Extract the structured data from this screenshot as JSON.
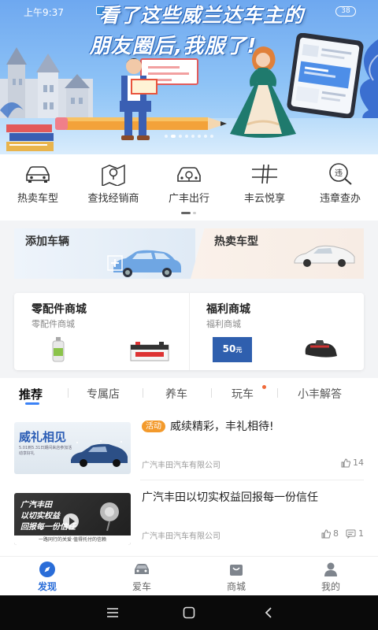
{
  "status_bar": {
    "time": "上午9:37",
    "battery": "38"
  },
  "banner": {
    "headline_line1": "看了这些威兰达车主的",
    "headline_line2": "朋友圈后,我服了!",
    "phone_caption": "朋友圈",
    "slide_count": 8,
    "active_slide": 1
  },
  "quick_menu": [
    {
      "label": "热卖车型",
      "icon": "car-front-icon"
    },
    {
      "label": "查找经销商",
      "icon": "map-pin-icon"
    },
    {
      "label": "广丰出行",
      "icon": "car-key-icon"
    },
    {
      "label": "丰云悦享",
      "icon": "road-sign-icon"
    },
    {
      "label": "违章查办",
      "icon": "violation-search-icon"
    }
  ],
  "promos": {
    "add_vehicle": "添加车辆",
    "hot_models": "热卖车型"
  },
  "mall": {
    "parts": {
      "title": "零配件商城",
      "subtitle": "零配件商城"
    },
    "welfare": {
      "title": "福利商城",
      "subtitle": "福利商城",
      "coupon_value": "50",
      "coupon_unit": "元"
    }
  },
  "tabs": [
    "推荐",
    "专属店",
    "养车",
    "玩车",
    "小丰解答"
  ],
  "active_tab": 0,
  "articles": [
    {
      "tag": "活动",
      "title": "威续精彩，丰礼相待!",
      "source": "广汽丰田汽车有限公司",
      "likes": "14",
      "thumb_title": "威礼相见",
      "thumb_sub": "5.01到5.31日期间来店参加活动享好礼"
    },
    {
      "title": "广汽丰田以切实权益回报每一份信任",
      "source": "广汽丰田汽车有限公司",
      "likes": "8",
      "comments": "1",
      "thumb_line1": "广汽丰田",
      "thumb_line2": "以切实权益",
      "thumb_line3": "回报每一份信任",
      "thumb_footer": "一路同行的关爱·值得托付的信赖"
    }
  ],
  "bottom_nav": [
    {
      "label": "发现",
      "icon": "compass-icon",
      "active": true
    },
    {
      "label": "爱车",
      "icon": "car-icon",
      "active": false
    },
    {
      "label": "商城",
      "icon": "shopping-bag-icon",
      "active": false
    },
    {
      "label": "我的",
      "icon": "user-icon",
      "active": false
    }
  ],
  "colors": {
    "accent": "#2a6dd8",
    "tag_orange": "#f39a2c",
    "tab_underline": "#3b82f6"
  }
}
